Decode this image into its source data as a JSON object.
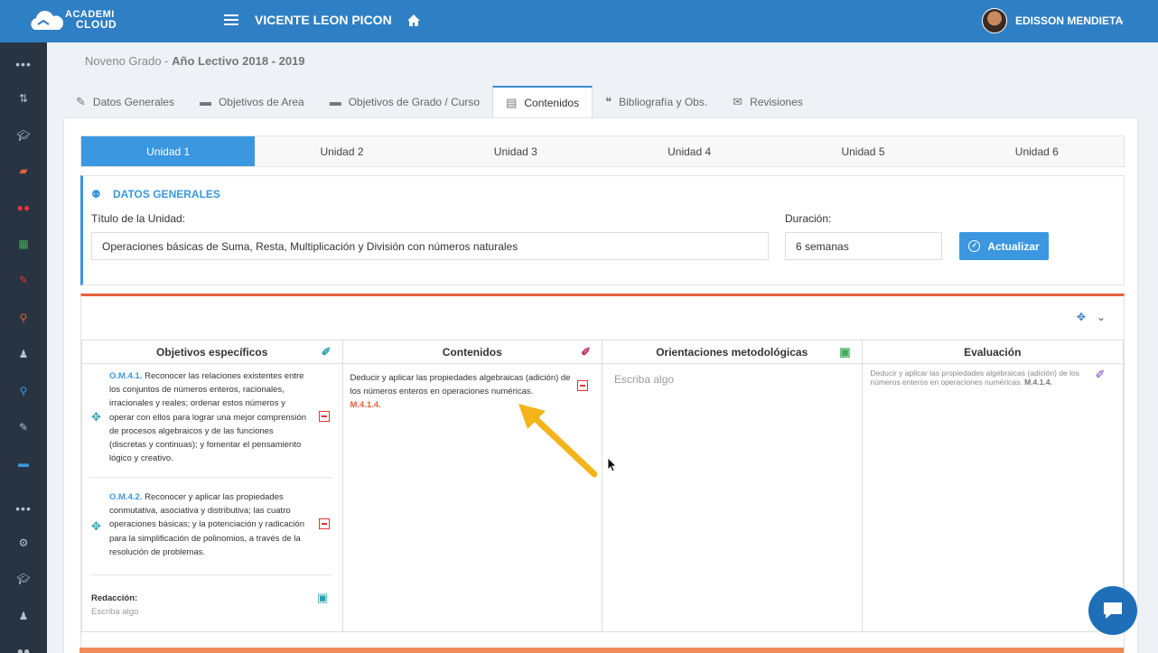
{
  "topbar": {
    "logo_line1": "ACADEMI",
    "logo_line2": "CLOUD",
    "school_name": "VICENTE LEON PICON",
    "user_name": "EDISSON MENDIETA"
  },
  "sidebar": {
    "icons": [
      "more-dots-icon",
      "sort-icon",
      "graduation-cap-icon",
      "folder-icon",
      "users-icon",
      "calendar-icon",
      "edit-icon",
      "search-icon",
      "user-tie-icon",
      "search-icon",
      "edit-icon",
      "briefcase-icon",
      "more-dots-icon",
      "cogs-icon",
      "graduation-cap-icon",
      "user-icon",
      "users-icon"
    ]
  },
  "breadcrumb": {
    "grade": "Noveno Grado",
    "sep": " - ",
    "year": "Año Lectivo 2018 - 2019"
  },
  "tabs": [
    {
      "label": "Datos Generales",
      "icon": "✎"
    },
    {
      "label": "Objetivos de Area",
      "icon": "▬"
    },
    {
      "label": "Objetivos de Grado / Curso",
      "icon": "▬"
    },
    {
      "label": "Contenidos",
      "icon": "▤"
    },
    {
      "label": "Bibliografía y Obs.",
      "icon": "❝"
    },
    {
      "label": "Revisiones",
      "icon": "✉"
    }
  ],
  "units": [
    "Unidad 1",
    "Unidad 2",
    "Unidad 3",
    "Unidad 4",
    "Unidad 5",
    "Unidad 6"
  ],
  "datos_generales": {
    "title": "DATOS GENERALES",
    "titulo_label": "Título de la Unidad:",
    "titulo_value": "Operaciones básicas de Suma, Resta, Multiplicación y División con números naturales",
    "duracion_label": "Duración:",
    "duracion_value": "6 semanas",
    "actualizar_label": "Actualizar"
  },
  "grid": {
    "headers": [
      "Objetivos específicos",
      "Contenidos",
      "Orientaciones metodológicas",
      "Evaluación"
    ],
    "objetivos": [
      {
        "code": "O.M.4.1.",
        "text": " Reconocer las relaciones existentes entre los conjuntos de números enteros, racionales, irracionales y reales; ordenar estos números y operar con ellos para lograr una mejor comprensión de procesos algebraicos y de las funciones (discretas y continuas); y fomentar el pensamiento lógico y creativo."
      },
      {
        "code": "O.M.4.2.",
        "text": " Reconocer y aplicar las propiedades conmutativa, asociativa y distributiva; las cuatro operaciones básicas; y la potenciación y radicación para la simplificación de polinomios, a través de la resolución de problemas."
      }
    ],
    "redaccion_label": "Redacción:",
    "redaccion_placeholder": "Escriba algo",
    "contenido_text": "Deducir y aplicar las propiedades algebraicas (adición) de los números enteros en operaciones numéricas.",
    "contenido_code": "M.4.1.4.",
    "orientaciones_placeholder": "Escriba algo",
    "evaluacion_text": "Deducir y aplicar las propiedades algebraicas (adición) de los números enteros en operaciones numéricas.",
    "evaluacion_code": "M.4.1.4."
  },
  "colors": {
    "topbar": "#2f7fc4",
    "sidebar": "#283442",
    "accent": "#3a97e0",
    "orange": "#e5603a",
    "remove_red": "#e5333a"
  }
}
